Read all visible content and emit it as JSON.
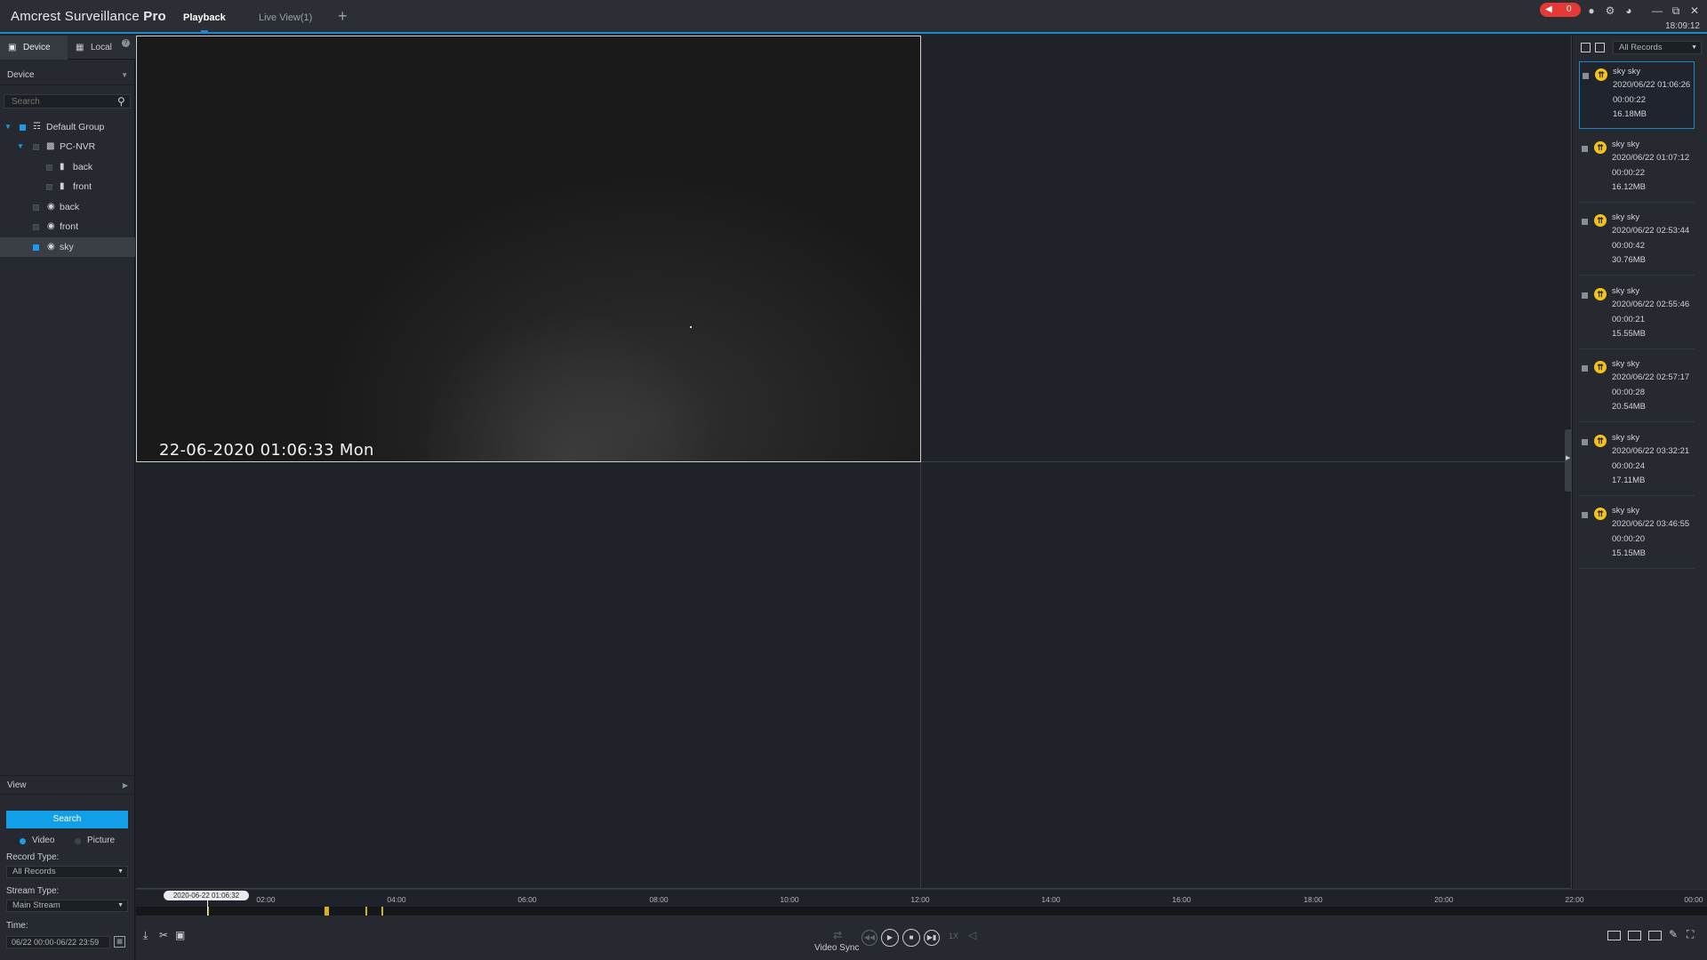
{
  "app": {
    "title_main": "Amcrest Surveillance",
    "title_bold": "Pro",
    "tabs": [
      {
        "label": "Playback"
      },
      {
        "label": "Live View(1)"
      }
    ],
    "add_tab": "+",
    "alarm_count": "0",
    "clock": "18:09:12"
  },
  "left_panel": {
    "tabs": [
      {
        "label": "Device"
      },
      {
        "label": "Local"
      }
    ],
    "device_header": "Device",
    "search_placeholder": "Search",
    "tree": [
      {
        "label": "Default Group"
      },
      {
        "label": "PC-NVR"
      },
      {
        "label": "back"
      },
      {
        "label": "front"
      },
      {
        "label": "back"
      },
      {
        "label": "front"
      },
      {
        "label": "sky"
      }
    ],
    "view_header": "View",
    "search_button": "Search",
    "radio_video": "Video",
    "radio_picture": "Picture",
    "record_type_label": "Record Type:",
    "record_type_value": "All Records",
    "stream_type_label": "Stream Type:",
    "stream_type_value": "Main Stream",
    "time_label": "Time:",
    "time_value": "06/22 00:00-06/22 23:59"
  },
  "video": {
    "osd_timestamp": "22-06-2020 01:06:33 Mon"
  },
  "records_panel": {
    "filter": "All Records",
    "records": [
      {
        "name": "sky sky",
        "start": "2020/06/22 01:06:26",
        "duration": "00:00:22",
        "size": "16.18MB"
      },
      {
        "name": "sky sky",
        "start": "2020/06/22 01:07:12",
        "duration": "00:00:22",
        "size": "16.12MB"
      },
      {
        "name": "sky sky",
        "start": "2020/06/22 02:53:44",
        "duration": "00:00:42",
        "size": "30.76MB"
      },
      {
        "name": "sky sky",
        "start": "2020/06/22 02:55:46",
        "duration": "00:00:21",
        "size": "15.55MB"
      },
      {
        "name": "sky sky",
        "start": "2020/06/22 02:57:17",
        "duration": "00:00:28",
        "size": "20.54MB"
      },
      {
        "name": "sky sky",
        "start": "2020/06/22 03:32:21",
        "duration": "00:00:24",
        "size": "17.11MB"
      },
      {
        "name": "sky sky",
        "start": "2020/06/22 03:46:55",
        "duration": "00:00:20",
        "size": "15.15MB"
      }
    ]
  },
  "timeline": {
    "current": "2020-06-22 01:06:32",
    "labels": [
      "02:00",
      "04:00",
      "06:00",
      "08:00",
      "10:00",
      "12:00",
      "14:00",
      "16:00",
      "18:00",
      "20:00",
      "22:00",
      "00:00"
    ]
  },
  "controls": {
    "video_sync": "Video Sync",
    "speed": "1X"
  },
  "icons": {
    "alarm": "speaker-icon",
    "user": "user-icon",
    "settings": "gear-icon",
    "performance": "gauge-icon",
    "motion": "running-person-icon"
  },
  "colors": {
    "accent": "#1e88c8",
    "search_button": "#119fe8",
    "alarm_badge": "#e53935",
    "record_mark": "#d4b01a"
  }
}
